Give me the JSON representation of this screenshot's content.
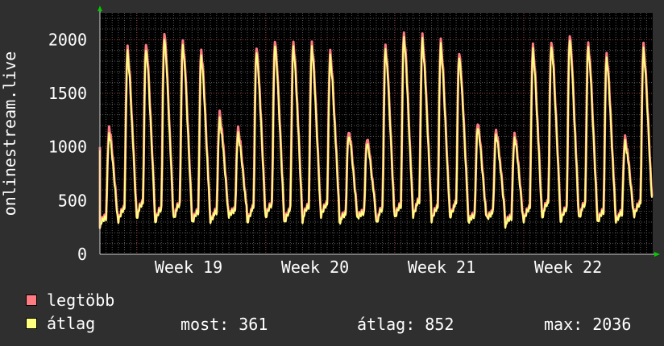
{
  "chart_data": {
    "type": "area",
    "ylabel": "onlinestream.live",
    "ylim": [
      0,
      2250
    ],
    "yticks": [
      0,
      500,
      1000,
      1500,
      2000
    ],
    "xticks": [
      "Week 19",
      "Week 20",
      "Week 21",
      "Week 22"
    ],
    "grid": true,
    "series": [
      {
        "name": "legtöbb",
        "color": "#ff7b82",
        "daily_peaks": [
          1180,
          1920,
          1980,
          2070,
          2000,
          1900,
          1320,
          1160,
          1940,
          1990,
          1980,
          1970,
          1880,
          1160,
          1080,
          1960,
          2060,
          2040,
          1980,
          1890,
          1220,
          1160,
          1120,
          1940,
          2000,
          2050,
          1980,
          1870,
          1090,
          1940
        ]
      },
      {
        "name": "átlag",
        "color": "#ffff80",
        "daily_peaks": [
          1120,
          1880,
          1930,
          2020,
          1960,
          1850,
          1260,
          1110,
          1900,
          1950,
          1940,
          1930,
          1840,
          1120,
          1040,
          1920,
          2020,
          2000,
          1940,
          1850,
          1180,
          1120,
          1080,
          1900,
          1960,
          2010,
          1940,
          1830,
          1050,
          1900
        ]
      }
    ]
  },
  "legend": [
    {
      "label": "legtöbb",
      "color": "#ff7b82"
    },
    {
      "label": "átlag",
      "color": "#ffff80"
    }
  ],
  "stats": {
    "now": "most: 361",
    "avg": "átlag: 852",
    "max": "max: 2036"
  },
  "colors": {
    "background": "#2f2f2f",
    "plot_background": "#000000",
    "grid_major": "#9a4040",
    "grid_minor": "#5a5a5a",
    "axis_arrow": "#00cc00",
    "text": "#ffffff"
  }
}
